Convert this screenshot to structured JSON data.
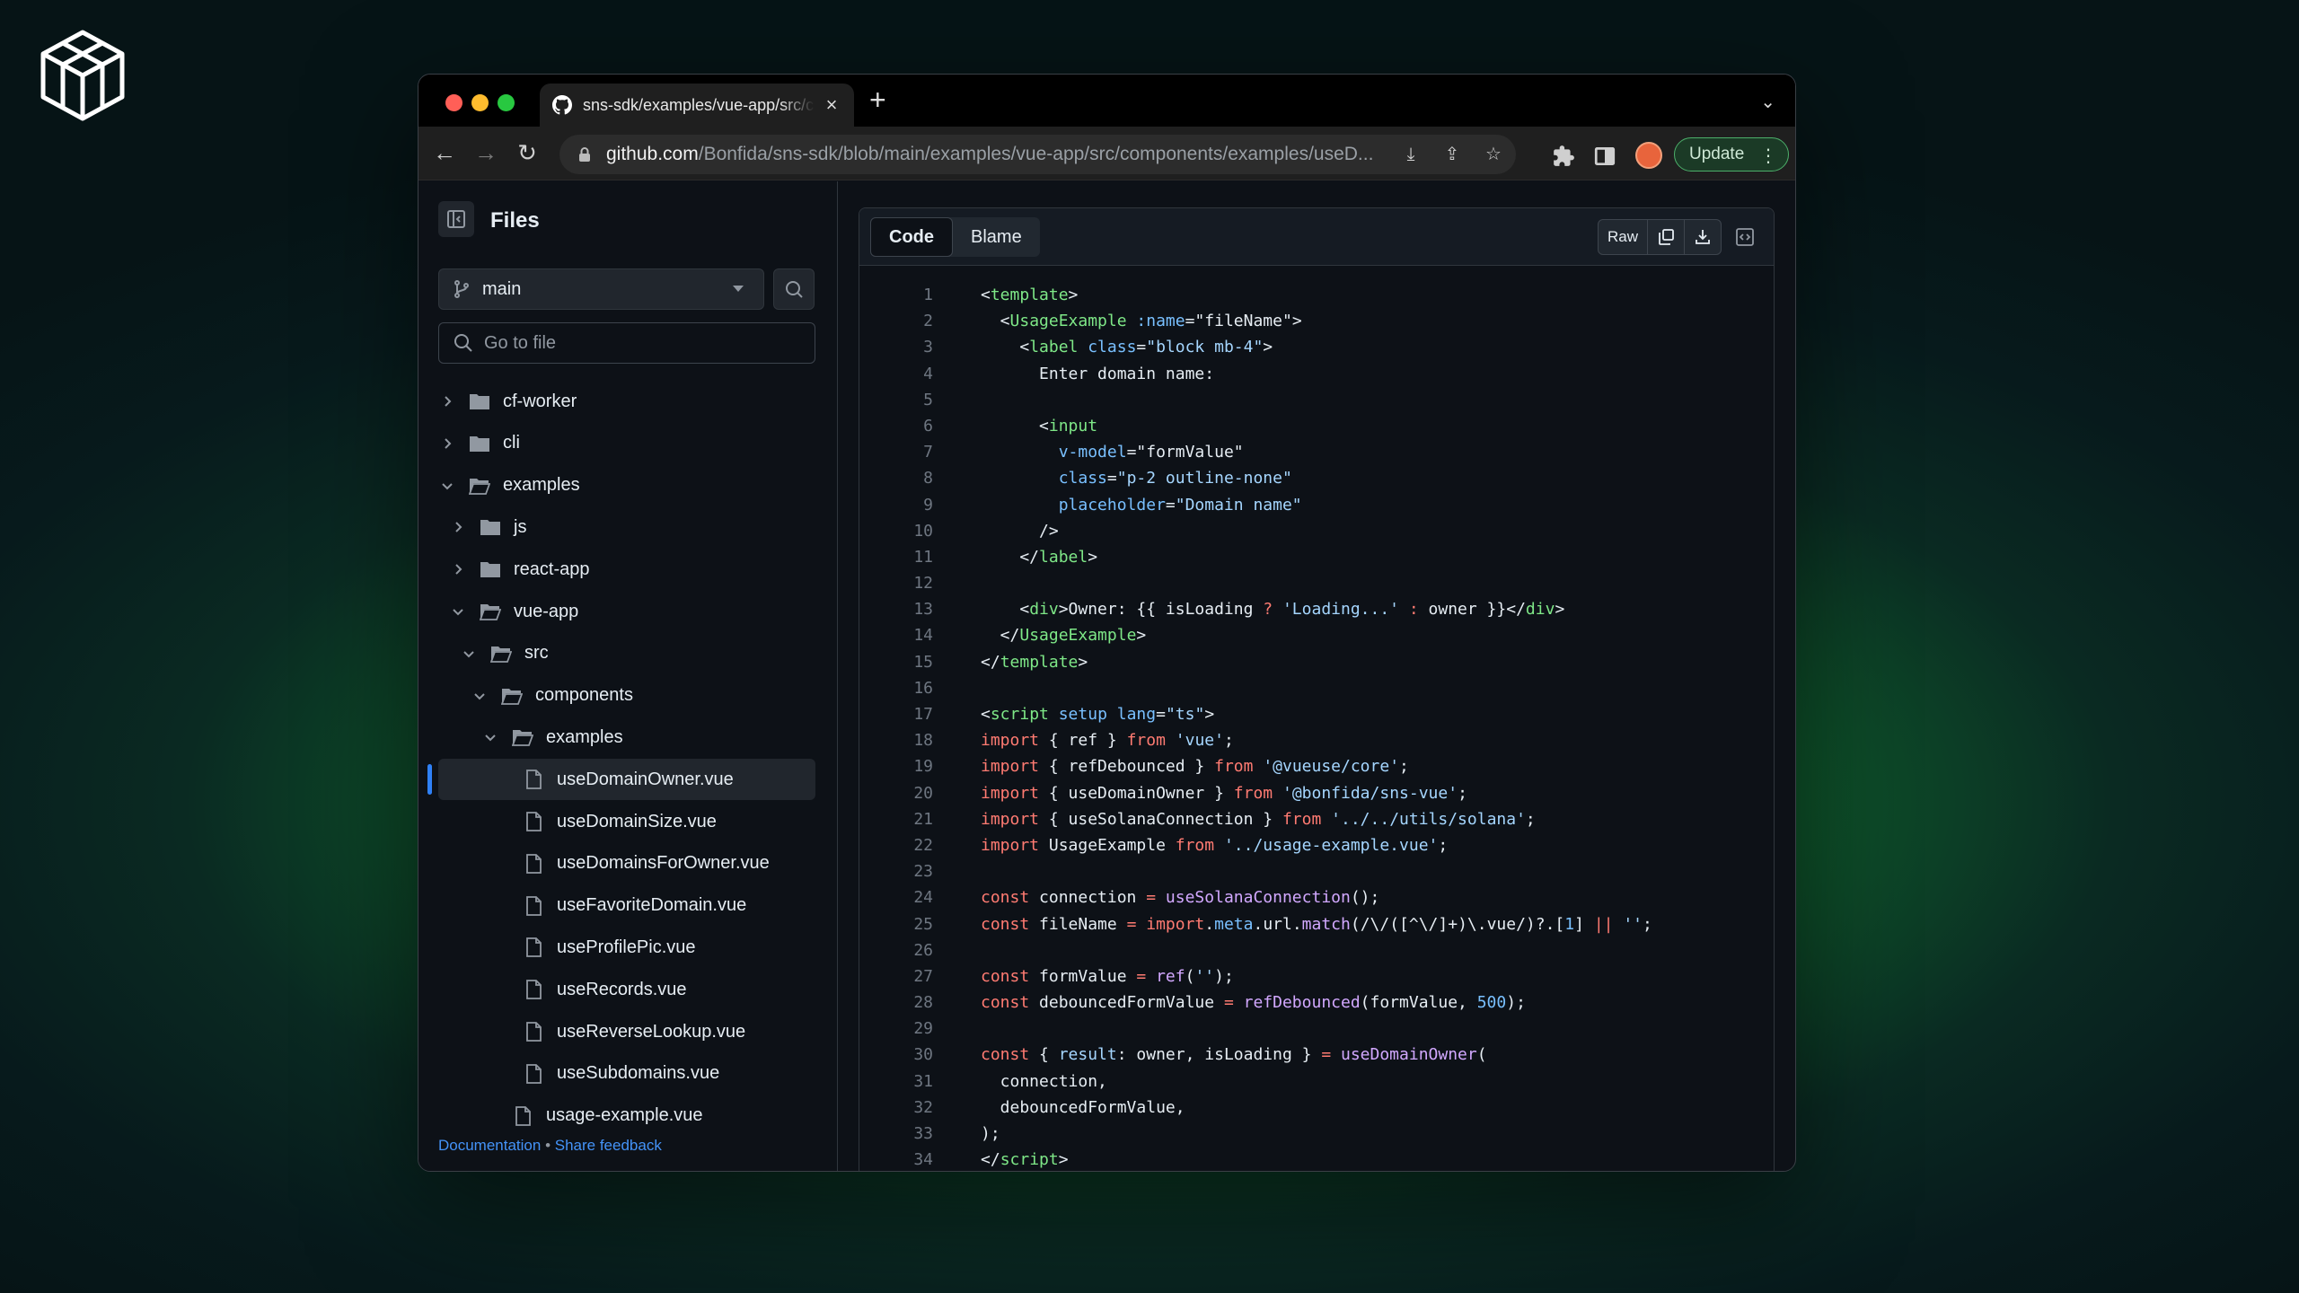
{
  "browser": {
    "tab_title": "sns-sdk/examples/vue-app/src/components/examples/useDomainOwner.vue at main · Bonfida/sns-sdk",
    "tab_close": "×",
    "new_tab": "+",
    "url_host": "github.com",
    "url_path": "/Bonfida/sns-sdk/blob/main/examples/vue-app/src/components/examples/useD...",
    "update_label": "Update"
  },
  "sidebar": {
    "title": "Files",
    "branch": "main",
    "goto_placeholder": "Go to file",
    "tree": [
      {
        "label": "cf-worker",
        "type": "dir",
        "open": false,
        "depth": 0
      },
      {
        "label": "cli",
        "type": "dir",
        "open": false,
        "depth": 0
      },
      {
        "label": "examples",
        "type": "dir",
        "open": true,
        "depth": 0
      },
      {
        "label": "js",
        "type": "dir",
        "open": false,
        "depth": 1
      },
      {
        "label": "react-app",
        "type": "dir",
        "open": false,
        "depth": 1
      },
      {
        "label": "vue-app",
        "type": "dir",
        "open": true,
        "depth": 1
      },
      {
        "label": "src",
        "type": "dir",
        "open": true,
        "depth": 2
      },
      {
        "label": "components",
        "type": "dir",
        "open": true,
        "depth": 3
      },
      {
        "label": "examples",
        "type": "dir",
        "open": true,
        "depth": 4
      },
      {
        "label": "useDomainOwner.vue",
        "type": "file",
        "depth": 5,
        "active": true
      },
      {
        "label": "useDomainSize.vue",
        "type": "file",
        "depth": 5
      },
      {
        "label": "useDomainsForOwner.vue",
        "type": "file",
        "depth": 5
      },
      {
        "label": "useFavoriteDomain.vue",
        "type": "file",
        "depth": 5
      },
      {
        "label": "useProfilePic.vue",
        "type": "file",
        "depth": 5
      },
      {
        "label": "useRecords.vue",
        "type": "file",
        "depth": 5
      },
      {
        "label": "useReverseLookup.vue",
        "type": "file",
        "depth": 5
      },
      {
        "label": "useSubdomains.vue",
        "type": "file",
        "depth": 5
      },
      {
        "label": "usage-example.vue",
        "type": "file",
        "depth": 4
      }
    ],
    "footer_doc": "Documentation",
    "footer_sep": " • ",
    "footer_feedback": "Share feedback"
  },
  "code_panel": {
    "tab_code": "Code",
    "tab_blame": "Blame",
    "raw_label": "Raw",
    "lines": [
      [
        [
          "t-pn",
          "<"
        ],
        [
          "t-tag",
          "template"
        ],
        [
          "t-pn",
          ">"
        ]
      ],
      [
        [
          "t-pn",
          "  <"
        ],
        [
          "t-tag",
          "UsageExample"
        ],
        [
          "t-pn",
          " "
        ],
        [
          "t-attr",
          ":name"
        ],
        [
          "t-pn",
          "="
        ],
        [
          "t-pn",
          "\"fileName\""
        ],
        [
          "t-pn",
          ">"
        ]
      ],
      [
        [
          "t-pn",
          "    <"
        ],
        [
          "t-tag",
          "label"
        ],
        [
          "t-pn",
          " "
        ],
        [
          "t-attr",
          "class"
        ],
        [
          "t-pn",
          "="
        ],
        [
          "t-str",
          "\"block mb-4\""
        ],
        [
          "t-pn",
          ">"
        ]
      ],
      [
        [
          "t-pn",
          "      Enter domain name:"
        ]
      ],
      [],
      [
        [
          "t-pn",
          "      <"
        ],
        [
          "t-tag",
          "input"
        ]
      ],
      [
        [
          "t-attr",
          "        v-model"
        ],
        [
          "t-pn",
          "="
        ],
        [
          "t-pn",
          "\"formValue\""
        ]
      ],
      [
        [
          "t-attr",
          "        class"
        ],
        [
          "t-pn",
          "="
        ],
        [
          "t-str",
          "\"p-2 outline-none\""
        ]
      ],
      [
        [
          "t-attr",
          "        placeholder"
        ],
        [
          "t-pn",
          "="
        ],
        [
          "t-str",
          "\"Domain name\""
        ]
      ],
      [
        [
          "t-pn",
          "      />"
        ]
      ],
      [
        [
          "t-pn",
          "    </"
        ],
        [
          "t-tag",
          "label"
        ],
        [
          "t-pn",
          ">"
        ]
      ],
      [],
      [
        [
          "t-pn",
          "    <"
        ],
        [
          "t-tag",
          "div"
        ],
        [
          "t-pn",
          ">Owner: {{ isLoading "
        ],
        [
          "t-kw",
          "?"
        ],
        [
          "t-pn",
          " "
        ],
        [
          "t-str",
          "'Loading...'"
        ],
        [
          "t-pn",
          " "
        ],
        [
          "t-kw",
          ":"
        ],
        [
          "t-pn",
          " owner }}</"
        ],
        [
          "t-tag",
          "div"
        ],
        [
          "t-pn",
          ">"
        ]
      ],
      [
        [
          "t-pn",
          "  </"
        ],
        [
          "t-tag",
          "UsageExample"
        ],
        [
          "t-pn",
          ">"
        ]
      ],
      [
        [
          "t-pn",
          "</"
        ],
        [
          "t-tag",
          "template"
        ],
        [
          "t-pn",
          ">"
        ]
      ],
      [],
      [
        [
          "t-pn",
          "<"
        ],
        [
          "t-tag",
          "script"
        ],
        [
          "t-pn",
          " "
        ],
        [
          "t-attr",
          "setup"
        ],
        [
          "t-pn",
          " "
        ],
        [
          "t-attr",
          "lang"
        ],
        [
          "t-pn",
          "="
        ],
        [
          "t-str",
          "\"ts\""
        ],
        [
          "t-pn",
          ">"
        ]
      ],
      [
        [
          "t-kw",
          "import"
        ],
        [
          "t-pn",
          " { ref } "
        ],
        [
          "t-kw",
          "from"
        ],
        [
          "t-pn",
          " "
        ],
        [
          "t-str",
          "'vue'"
        ],
        [
          "t-pn",
          ";"
        ]
      ],
      [
        [
          "t-kw",
          "import"
        ],
        [
          "t-pn",
          " { refDebounced } "
        ],
        [
          "t-kw",
          "from"
        ],
        [
          "t-pn",
          " "
        ],
        [
          "t-str",
          "'@vueuse/core'"
        ],
        [
          "t-pn",
          ";"
        ]
      ],
      [
        [
          "t-kw",
          "import"
        ],
        [
          "t-pn",
          " { useDomainOwner } "
        ],
        [
          "t-kw",
          "from"
        ],
        [
          "t-pn",
          " "
        ],
        [
          "t-str",
          "'@bonfida/sns-vue'"
        ],
        [
          "t-pn",
          ";"
        ]
      ],
      [
        [
          "t-kw",
          "import"
        ],
        [
          "t-pn",
          " { useSolanaConnection } "
        ],
        [
          "t-kw",
          "from"
        ],
        [
          "t-pn",
          " "
        ],
        [
          "t-str",
          "'../../utils/solana'"
        ],
        [
          "t-pn",
          ";"
        ]
      ],
      [
        [
          "t-kw",
          "import"
        ],
        [
          "t-pn",
          " UsageExample "
        ],
        [
          "t-kw",
          "from"
        ],
        [
          "t-pn",
          " "
        ],
        [
          "t-str",
          "'../usage-example.vue'"
        ],
        [
          "t-pn",
          ";"
        ]
      ],
      [],
      [
        [
          "t-kw",
          "const"
        ],
        [
          "t-pn",
          " connection "
        ],
        [
          "t-kw",
          "="
        ],
        [
          "t-pn",
          " "
        ],
        [
          "t-fn",
          "useSolanaConnection"
        ],
        [
          "t-pn",
          "();"
        ]
      ],
      [
        [
          "t-kw",
          "const"
        ],
        [
          "t-pn",
          " fileName "
        ],
        [
          "t-kw",
          "="
        ],
        [
          "t-pn",
          " "
        ],
        [
          "t-kw",
          "import"
        ],
        [
          "t-pn",
          "."
        ],
        [
          "t-attr",
          "meta"
        ],
        [
          "t-pn",
          ".url."
        ],
        [
          "t-fn",
          "match"
        ],
        [
          "t-pn",
          "(/\\/([^\\/]+)\\.vue/)?.["
        ],
        [
          "t-num",
          "1"
        ],
        [
          "t-pn",
          "] "
        ],
        [
          "t-kw",
          "||"
        ],
        [
          "t-pn",
          " "
        ],
        [
          "t-str",
          "''"
        ],
        [
          "t-pn",
          ";"
        ]
      ],
      [],
      [
        [
          "t-kw",
          "const"
        ],
        [
          "t-pn",
          " formValue "
        ],
        [
          "t-kw",
          "="
        ],
        [
          "t-pn",
          " "
        ],
        [
          "t-fn",
          "ref"
        ],
        [
          "t-pn",
          "("
        ],
        [
          "t-str",
          "''"
        ],
        [
          "t-pn",
          ");"
        ]
      ],
      [
        [
          "t-kw",
          "const"
        ],
        [
          "t-pn",
          " debouncedFormValue "
        ],
        [
          "t-kw",
          "="
        ],
        [
          "t-pn",
          " "
        ],
        [
          "t-fn",
          "refDebounced"
        ],
        [
          "t-pn",
          "(formValue, "
        ],
        [
          "t-num",
          "500"
        ],
        [
          "t-pn",
          ");"
        ]
      ],
      [],
      [
        [
          "t-kw",
          "const"
        ],
        [
          "t-pn",
          " { "
        ],
        [
          "t-str",
          "result"
        ],
        [
          "t-pn",
          ": owner, isLoading } "
        ],
        [
          "t-kw",
          "="
        ],
        [
          "t-pn",
          " "
        ],
        [
          "t-fn",
          "useDomainOwner"
        ],
        [
          "t-pn",
          "("
        ]
      ],
      [
        [
          "t-pn",
          "  connection,"
        ]
      ],
      [
        [
          "t-pn",
          "  debouncedFormValue,"
        ]
      ],
      [
        [
          "t-pn",
          ");"
        ]
      ],
      [
        [
          "t-pn",
          "</"
        ],
        [
          "t-tag",
          "script"
        ],
        [
          "t-pn",
          ">"
        ]
      ]
    ]
  }
}
